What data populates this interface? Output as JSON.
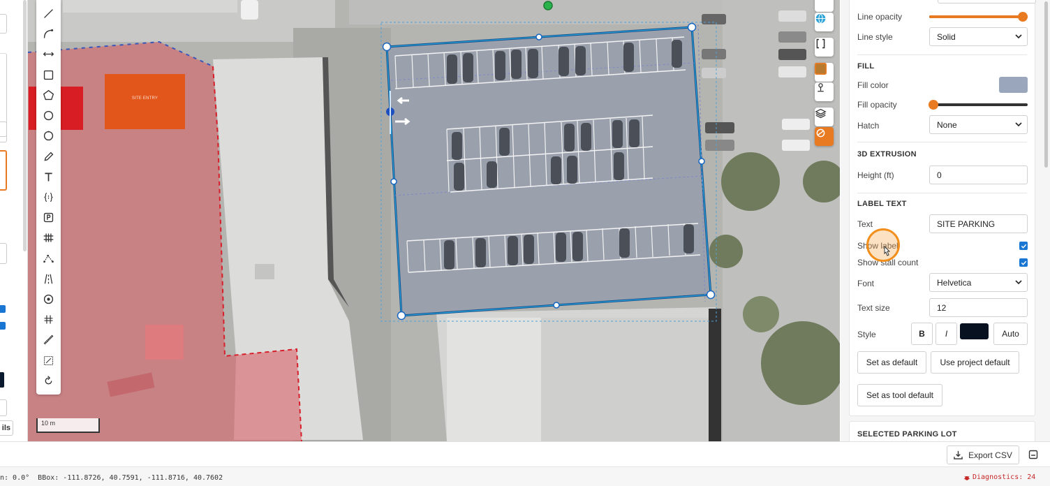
{
  "left_panel": {
    "details_label": "ils"
  },
  "map": {
    "site_label": "SITE ENTRY",
    "scale": "10 m",
    "tools": [
      "line-tool",
      "arc-tool",
      "measure-tool",
      "rectangle-tool",
      "polygon-tool",
      "circle-tool",
      "circle-outline-tool",
      "pencil-tool",
      "text-tool",
      "bracket-tool",
      "parking-tool",
      "grid-tool",
      "path-tool",
      "road-tool",
      "target-tool",
      "hash-tool",
      "ruler-tool",
      "select-area-tool",
      "rotate-tool"
    ]
  },
  "props": {
    "line_opacity_label": "Line opacity",
    "line_opacity_value": 0.95,
    "line_style_label": "Line style",
    "line_style_value": "Solid",
    "fill_header": "FILL",
    "fill_color_label": "Fill color",
    "fill_color": "#9aa6bb",
    "fill_opacity_label": "Fill opacity",
    "fill_opacity_value": 0.0,
    "hatch_label": "Hatch",
    "hatch_value": "None",
    "extrusion_header": "3D EXTRUSION",
    "height_label": "Height (ft)",
    "height_value": "0",
    "label_header": "LABEL TEXT",
    "text_label": "Text",
    "text_value": "SITE PARKING",
    "show_label_label": "Show label",
    "show_label_checked": true,
    "show_stall_label": "Show stall count",
    "show_stall_checked": true,
    "font_label": "Font",
    "font_value": "Helvetica",
    "text_size_label": "Text size",
    "text_size_value": "12",
    "style_label": "Style",
    "bold_label": "B",
    "italic_label": "I",
    "text_color": "#07111f",
    "auto_label": "Auto",
    "set_default_label": "Set as default",
    "project_default_label": "Use project default",
    "tool_default_label": "Set as tool default",
    "selected_header": "SELECTED PARKING LOT"
  },
  "bottom": {
    "export_label": "Export CSV"
  },
  "status": {
    "coords": "n: 0.0°  BBox: -111.8726, 40.7591, -111.8716, 40.7602",
    "diagnostics": "Diagnostics: 24"
  },
  "colors": {
    "accent": "#e87a22",
    "selection": "#1976d2",
    "danger": "#c62828"
  }
}
